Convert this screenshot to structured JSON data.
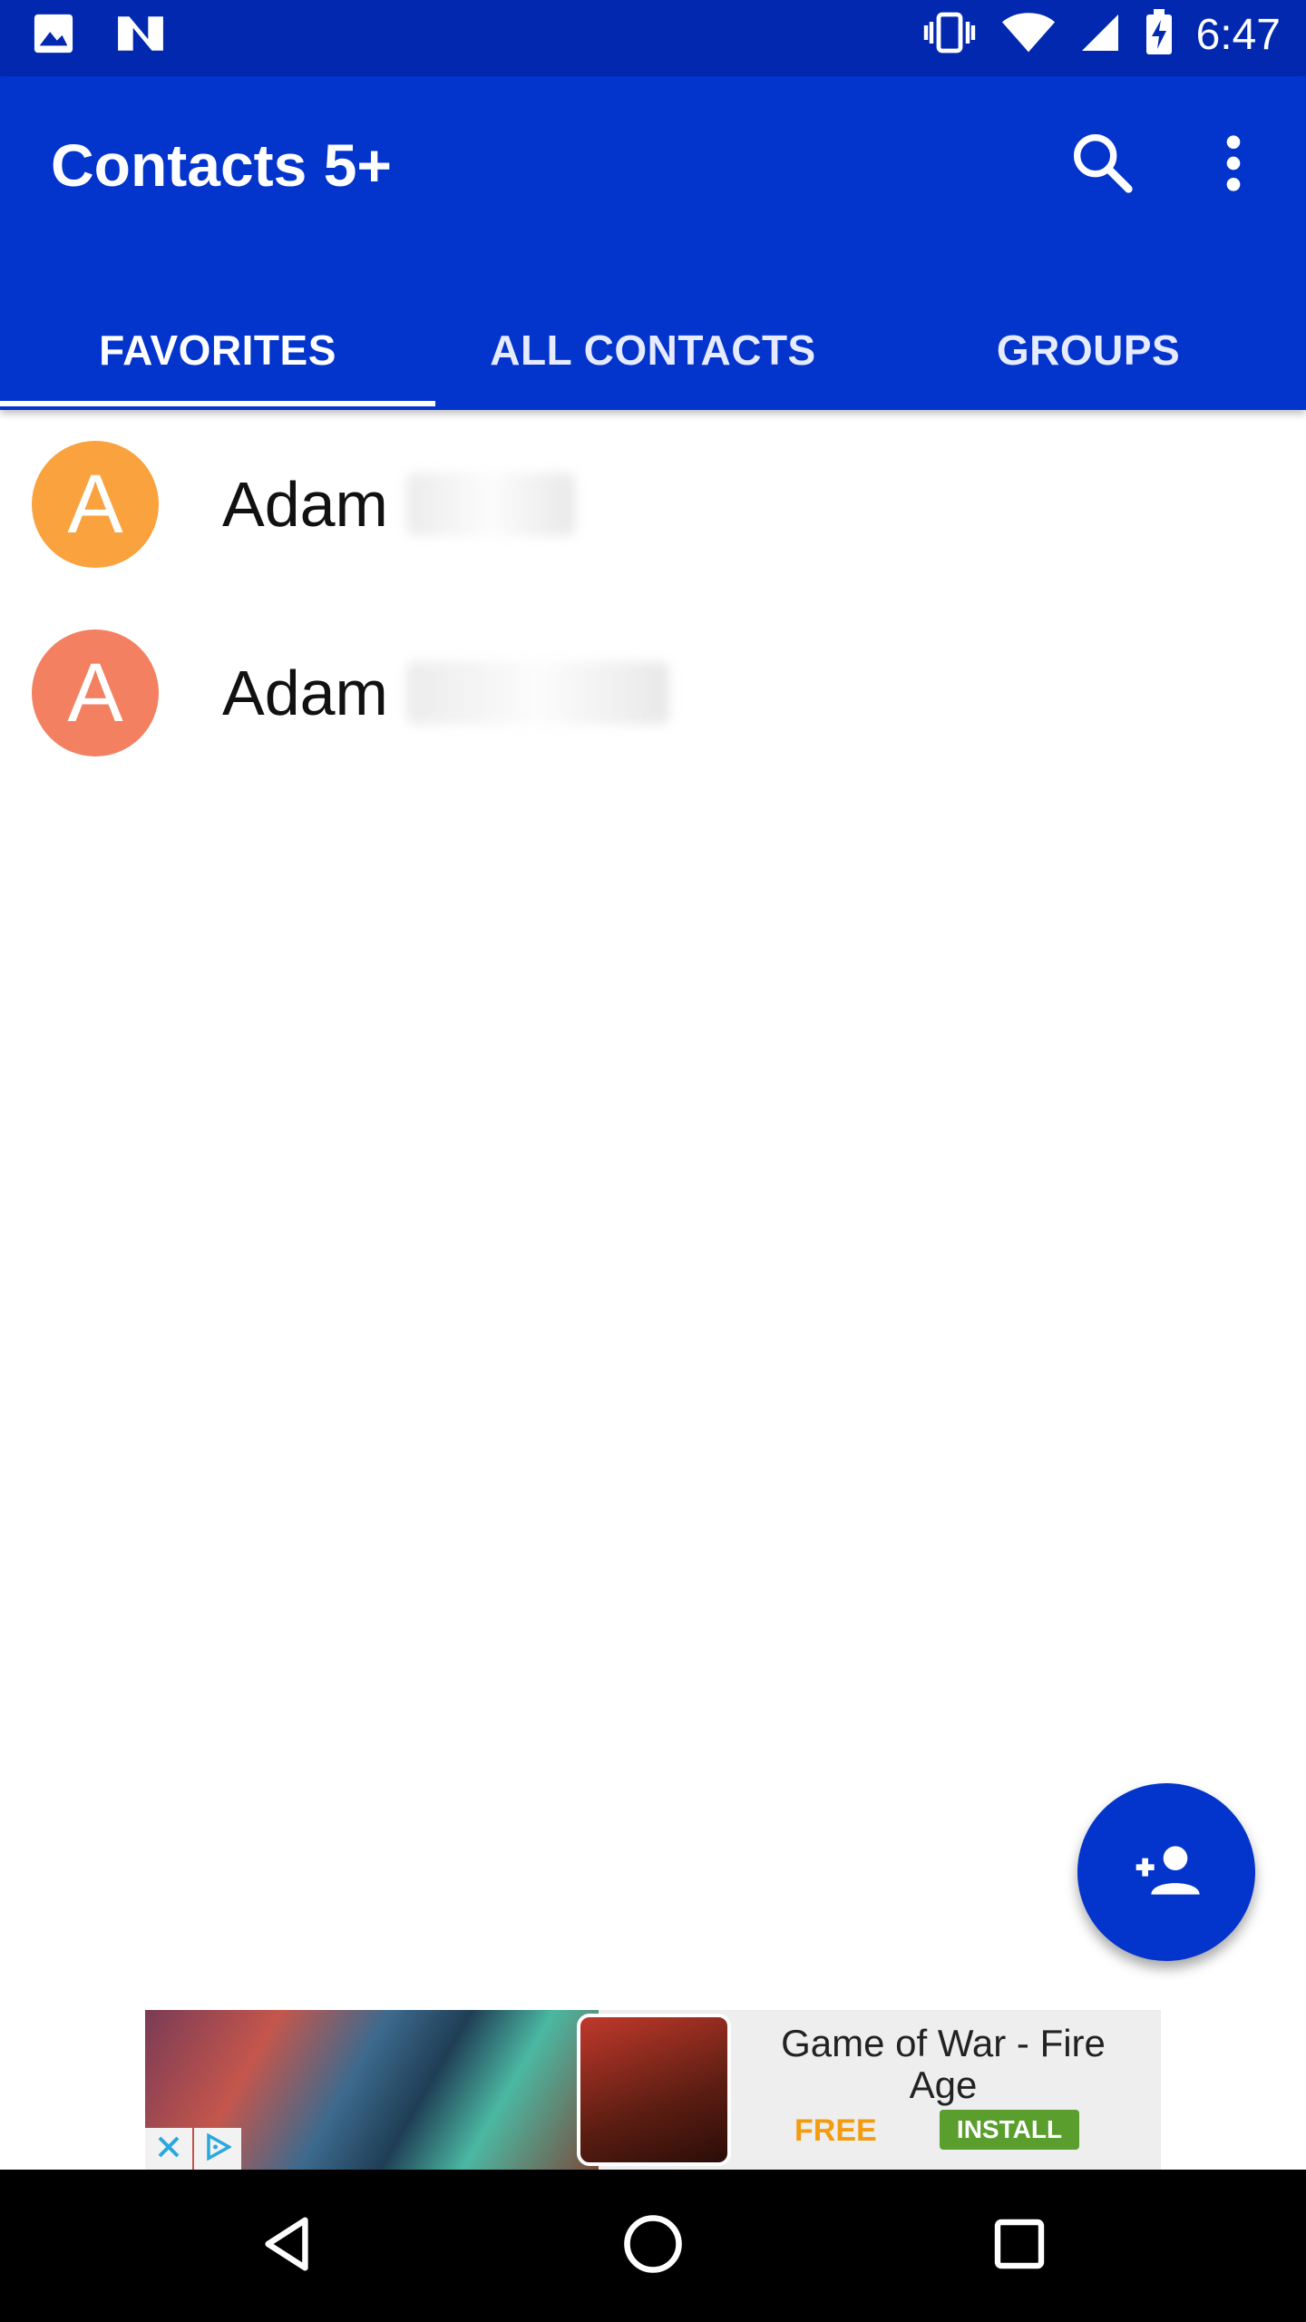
{
  "status_bar": {
    "time": "6:47",
    "left_icons": [
      "image-notification-icon",
      "n-notification-icon"
    ],
    "right_icons": [
      "vibrate-icon",
      "wifi-icon",
      "signal-icon",
      "battery-charging-icon"
    ]
  },
  "app_bar": {
    "title": "Contacts 5+",
    "actions": [
      "search-icon",
      "more-vert-icon"
    ],
    "background": "#0334cc"
  },
  "tabs": [
    {
      "label": "FAVORITES",
      "selected": true
    },
    {
      "label": "ALL CONTACTS",
      "selected": false
    },
    {
      "label": "GROUPS",
      "selected": false
    }
  ],
  "contacts": [
    {
      "initial": "A",
      "first_name": "Adam",
      "avatar_color": "#f9a23e"
    },
    {
      "initial": "A",
      "first_name": "Adam",
      "avatar_color": "#f38061"
    }
  ],
  "fab": {
    "icon": "add-person-icon",
    "color": "#0334cc"
  },
  "ad": {
    "title": "Game of War - Fire Age",
    "price": "FREE",
    "cta": "INSTALL"
  },
  "nav_bar": {
    "buttons": [
      "back-icon",
      "home-icon",
      "recents-icon"
    ]
  }
}
